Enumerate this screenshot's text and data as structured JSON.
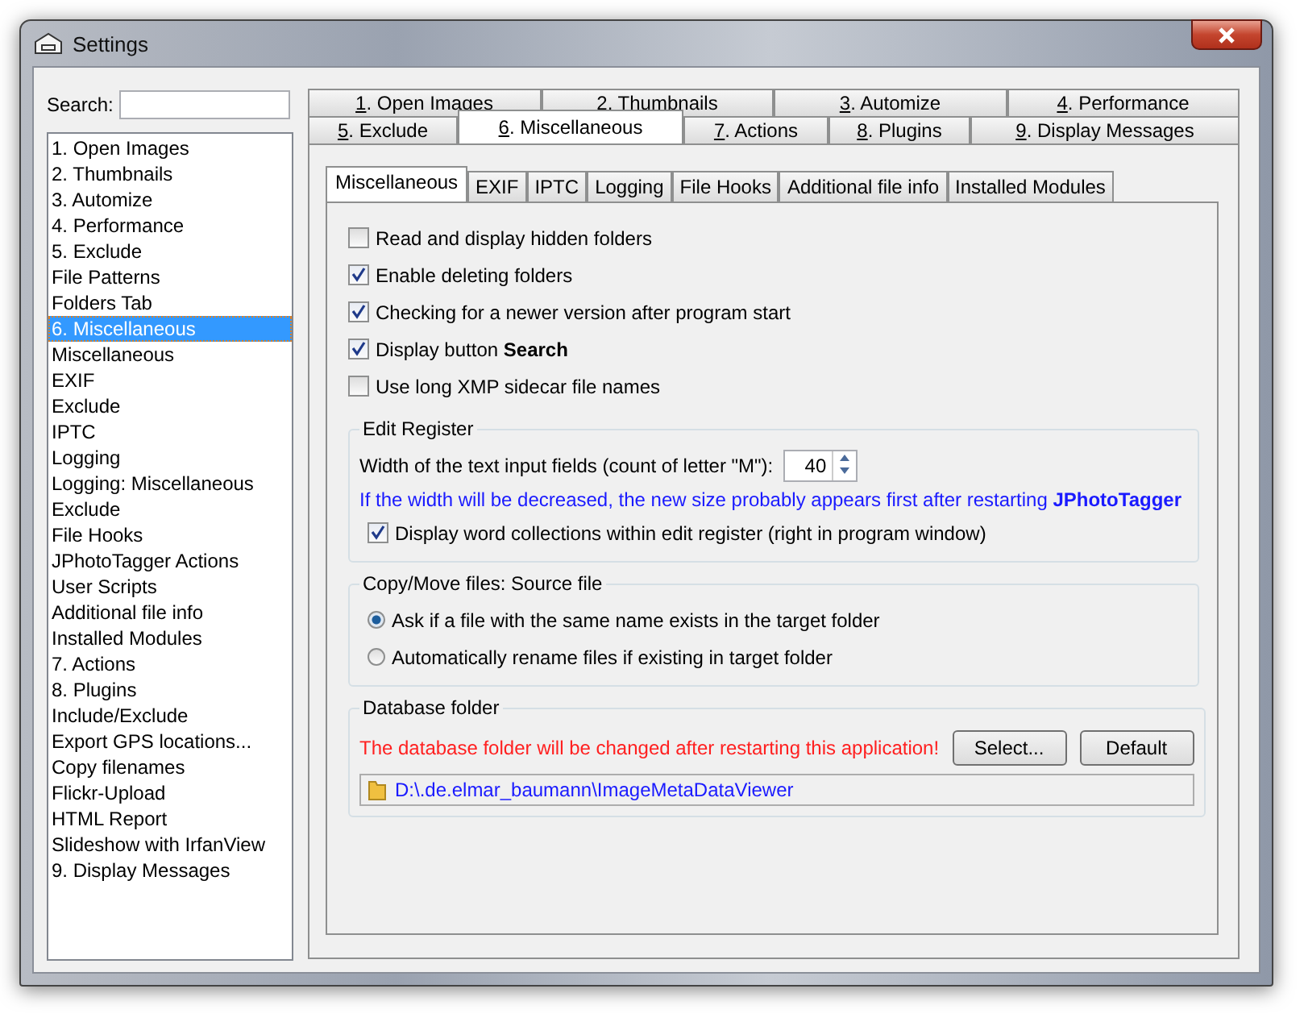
{
  "window": {
    "title": "Settings"
  },
  "search": {
    "label": "Search:"
  },
  "sidebar": {
    "items": [
      {
        "label": "1. Open Images",
        "selected": false
      },
      {
        "label": "2. Thumbnails",
        "selected": false
      },
      {
        "label": "3. Automize",
        "selected": false
      },
      {
        "label": "4. Performance",
        "selected": false
      },
      {
        "label": "5. Exclude",
        "selected": false
      },
      {
        "label": "File Patterns",
        "selected": false
      },
      {
        "label": "Folders Tab",
        "selected": false
      },
      {
        "label": "6. Miscellaneous",
        "selected": true
      },
      {
        "label": "Miscellaneous",
        "selected": false
      },
      {
        "label": "EXIF",
        "selected": false
      },
      {
        "label": "Exclude",
        "selected": false
      },
      {
        "label": "IPTC",
        "selected": false
      },
      {
        "label": "Logging",
        "selected": false
      },
      {
        "label": "Logging: Miscellaneous",
        "selected": false
      },
      {
        "label": "Exclude",
        "selected": false
      },
      {
        "label": "File Hooks",
        "selected": false
      },
      {
        "label": "JPhotoTagger Actions",
        "selected": false
      },
      {
        "label": "User Scripts",
        "selected": false
      },
      {
        "label": "Additional file info",
        "selected": false
      },
      {
        "label": "Installed Modules",
        "selected": false
      },
      {
        "label": "7. Actions",
        "selected": false
      },
      {
        "label": "8. Plugins",
        "selected": false
      },
      {
        "label": "Include/Exclude",
        "selected": false
      },
      {
        "label": "Export GPS locations...",
        "selected": false
      },
      {
        "label": "Copy filenames",
        "selected": false
      },
      {
        "label": "Flickr-Upload",
        "selected": false
      },
      {
        "label": "HTML Report",
        "selected": false
      },
      {
        "label": "Slideshow with IrfanView",
        "selected": false
      },
      {
        "label": "9. Display Messages",
        "selected": false
      }
    ]
  },
  "tabs": {
    "back_row": [
      {
        "label": "1. Open Images",
        "selected": false
      },
      {
        "label": "2. Thumbnails",
        "selected": false
      },
      {
        "label": "3. Automize",
        "selected": false
      },
      {
        "label": "4. Performance",
        "selected": false
      }
    ],
    "front_row": [
      {
        "label": "5. Exclude",
        "selected": false
      },
      {
        "label": "6. Miscellaneous",
        "selected": true
      },
      {
        "label": "7. Actions",
        "selected": false
      },
      {
        "label": "8. Plugins",
        "selected": false
      },
      {
        "label": "9. Display Messages",
        "selected": false
      }
    ]
  },
  "sub_tabs": [
    {
      "label": "Miscellaneous",
      "selected": true
    },
    {
      "label": "EXIF",
      "selected": false
    },
    {
      "label": "IPTC",
      "selected": false
    },
    {
      "label": "Logging",
      "selected": false
    },
    {
      "label": "File Hooks",
      "selected": false
    },
    {
      "label": "Additional file info",
      "selected": false
    },
    {
      "label": "Installed Modules",
      "selected": false
    }
  ],
  "options": [
    {
      "label": "Read and display hidden folders",
      "checked": false
    },
    {
      "label": "Enable deleting folders",
      "checked": true
    },
    {
      "label": "Checking for a newer version after program start",
      "checked": true
    },
    {
      "label": "Display button **Search**",
      "checked": true
    },
    {
      "label": "Use long XMP sidecar file names",
      "checked": false
    }
  ],
  "edit_register": {
    "title": "Edit Register",
    "width_label": "Width of the text input fields (count of letter \"M\"):",
    "width_value": "40",
    "hint": "If the width will be decreased, the new size probably appears first after restarting **JPhotoTagger**",
    "word_collections": {
      "label": "Display word collections within edit register (right in program window)",
      "checked": true
    }
  },
  "copy_move": {
    "title": "Copy/Move files: Source file",
    "choices": [
      {
        "label": "Ask if a file with the same name exists in the target folder",
        "selected": true
      },
      {
        "label": "Automatically rename files if existing in target folder",
        "selected": false
      }
    ]
  },
  "database": {
    "title": "Database folder",
    "warning": "The database folder will be changed after restarting this application!",
    "buttons": [
      "Select...",
      "Default"
    ],
    "path": "D:\\.de.elmar_baumann\\ImageMetaDataViewer"
  }
}
